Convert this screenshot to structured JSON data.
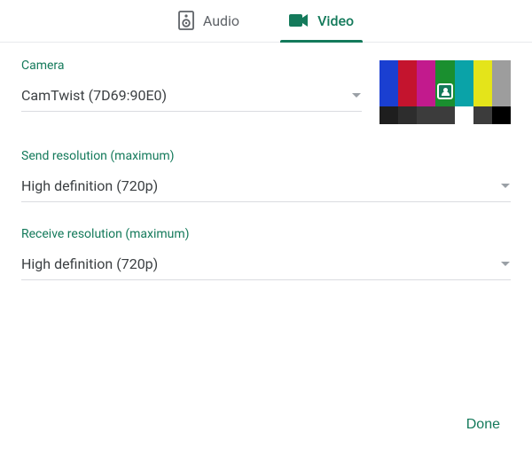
{
  "tabs": {
    "audio": {
      "label": "Audio"
    },
    "video": {
      "label": "Video"
    }
  },
  "camera": {
    "label": "Camera",
    "value": "CamTwist (7D69:90E0)"
  },
  "send_resolution": {
    "label": "Send resolution (maximum)",
    "value": "High definition (720p)"
  },
  "receive_resolution": {
    "label": "Receive resolution (maximum)",
    "value": "High definition (720p)"
  },
  "footer": {
    "done": "Done"
  },
  "colors": {
    "accent": "#147a5b"
  }
}
